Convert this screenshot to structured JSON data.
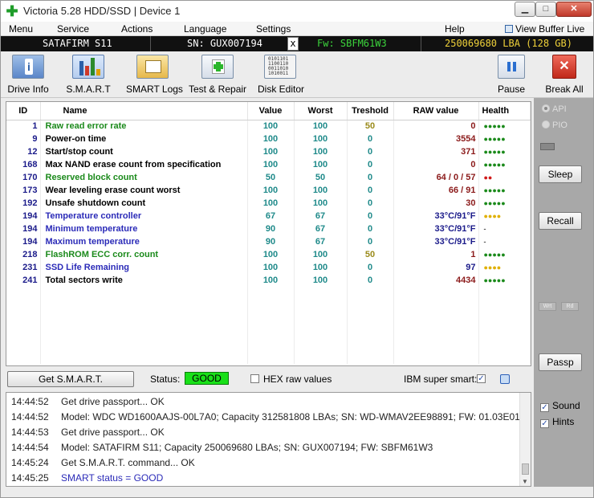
{
  "window": {
    "title": "Victoria 5.28 HDD/SSD | Device 1"
  },
  "menu": [
    "Menu",
    "Service",
    "Actions",
    "Language",
    "Settings",
    "Help"
  ],
  "buffer_link": "View Buffer Live",
  "device": {
    "model": "SATAFIRM   S11",
    "sn": "SN: GUX007194",
    "close": "x",
    "fw": "Fw: SBFM61W3",
    "lba": "250069680 LBA (128 GB)"
  },
  "toolbar": {
    "drive_info": "Drive Info",
    "smart": "S.M.A.R.T",
    "smart_logs": "SMART Logs",
    "test_repair": "Test & Repair",
    "disk_editor": "Disk Editor",
    "pause": "Pause",
    "break_all": "Break All"
  },
  "table": {
    "headers": {
      "id": "ID",
      "name": "Name",
      "value": "Value",
      "worst": "Worst",
      "threshold": "Treshold",
      "raw": "RAW value",
      "health": "Health"
    },
    "rows": [
      {
        "id": "1",
        "name": "Raw read error rate",
        "value": "100",
        "worst": "100",
        "threshold": "50",
        "raw": "0",
        "health": "●●●●●",
        "name_color": "green",
        "health_color": "green"
      },
      {
        "id": "9",
        "name": "Power-on time",
        "value": "100",
        "worst": "100",
        "threshold": "0",
        "raw": "3554",
        "health": "●●●●●",
        "name_color": "black",
        "health_color": "green"
      },
      {
        "id": "12",
        "name": "Start/stop count",
        "value": "100",
        "worst": "100",
        "threshold": "0",
        "raw": "371",
        "health": "●●●●●",
        "name_color": "black",
        "health_color": "green"
      },
      {
        "id": "168",
        "name": "Max NAND erase count from specification",
        "value": "100",
        "worst": "100",
        "threshold": "0",
        "raw": "0",
        "health": "●●●●●",
        "name_color": "black",
        "health_color": "green"
      },
      {
        "id": "170",
        "name": "Reserved block count",
        "value": "50",
        "worst": "50",
        "threshold": "0",
        "raw": "64 / 0 / 57",
        "health": "●●",
        "name_color": "green",
        "health_color": "red"
      },
      {
        "id": "173",
        "name": "Wear leveling erase count worst",
        "value": "100",
        "worst": "100",
        "threshold": "0",
        "raw": "66 / 91",
        "health": "●●●●●",
        "name_color": "black",
        "health_color": "green"
      },
      {
        "id": "192",
        "name": "Unsafe shutdown count",
        "value": "100",
        "worst": "100",
        "threshold": "0",
        "raw": "30",
        "health": "●●●●●",
        "name_color": "black",
        "health_color": "green"
      },
      {
        "id": "194",
        "name": "Temperature controller",
        "value": "67",
        "worst": "67",
        "threshold": "0",
        "raw": "33°C/91°F",
        "health": "●●●●",
        "name_color": "blue",
        "health_color": "yellow",
        "raw_color": "blue"
      },
      {
        "id": "194",
        "name": "Minimum temperature",
        "value": "90",
        "worst": "67",
        "threshold": "0",
        "raw": "33°C/91°F",
        "health": "-",
        "name_color": "blue",
        "health_color": "dash",
        "raw_color": "blue"
      },
      {
        "id": "194",
        "name": "Maximum temperature",
        "value": "90",
        "worst": "67",
        "threshold": "0",
        "raw": "33°C/91°F",
        "health": "-",
        "name_color": "blue",
        "health_color": "dash",
        "raw_color": "blue"
      },
      {
        "id": "218",
        "name": "FlashROM ECC corr. count",
        "value": "100",
        "worst": "100",
        "threshold": "50",
        "raw": "1",
        "health": "●●●●●",
        "name_color": "green",
        "health_color": "green"
      },
      {
        "id": "231",
        "name": "SSD Life Remaining",
        "value": "100",
        "worst": "100",
        "threshold": "0",
        "raw": "97",
        "health": "●●●●",
        "name_color": "blue",
        "health_color": "yellow",
        "raw_color": "blue"
      },
      {
        "id": "241",
        "name": "Total sectors write",
        "value": "100",
        "worst": "100",
        "threshold": "0",
        "raw": "4434",
        "health": "●●●●●",
        "name_color": "black",
        "health_color": "green"
      }
    ]
  },
  "side": {
    "api": "API",
    "pio": "PIO",
    "sleep": "Sleep",
    "recall": "Recall",
    "mini1": "Wrt",
    "mini2": "Rd",
    "passp": "Passp"
  },
  "statusbar": {
    "get_smart": "Get S.M.A.R.T.",
    "status_label": "Status:",
    "status_value": "GOOD",
    "hex_label": "HEX raw values",
    "ibm_label": "IBM super smart:"
  },
  "log": [
    {
      "time": "14:44:52",
      "msg": "Get drive passport... OK"
    },
    {
      "time": "14:44:52",
      "msg": "Model: WDC WD1600AAJS-00L7A0; Capacity 312581808 LBAs; SN: WD-WMAV2EE98891; FW: 01.03E01"
    },
    {
      "time": "14:44:53",
      "msg": "Get drive passport... OK"
    },
    {
      "time": "14:44:54",
      "msg": "Model: SATAFIRM   S11; Capacity 250069680 LBAs; SN: GUX007194; FW: SBFM61W3"
    },
    {
      "time": "14:45:24",
      "msg": "Get S.M.A.R.T. command... OK"
    },
    {
      "time": "14:45:25",
      "msg": "SMART status = GOOD",
      "blue": true
    }
  ],
  "log_side": {
    "sound": "Sound",
    "hints": "Hints"
  }
}
